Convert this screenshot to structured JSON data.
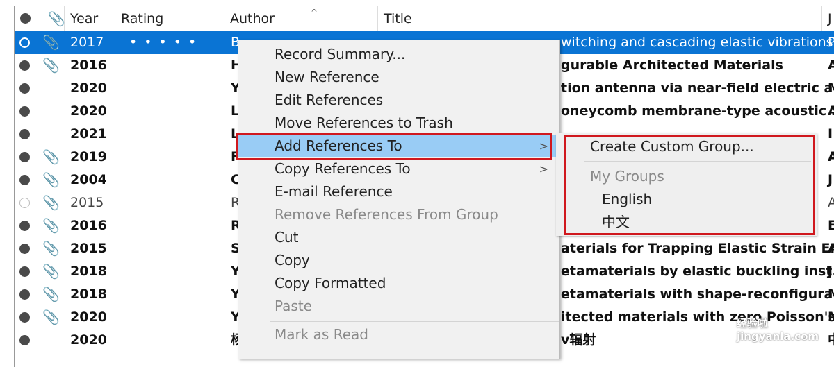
{
  "columns": {
    "year": "Year",
    "rating": "Rating",
    "author": "Author",
    "title": "Title",
    "journal": "J"
  },
  "icons": {
    "read_status": "circle-dot-icon",
    "attachment": "paperclip-icon",
    "sort": "chevron-up-icon",
    "submenu": "chevron-right-icon"
  },
  "rows": [
    {
      "year": "2017",
      "rating": "• • • • •",
      "author": "B",
      "title": "witching and cascading elastic vibrations",
      "journal": "P",
      "attach": true,
      "state": "selected"
    },
    {
      "year": "2016",
      "author": "H",
      "title": "gurable Architected Materials",
      "journal": "A",
      "attach": true,
      "state": "unread"
    },
    {
      "year": "2020",
      "author": "Y",
      "title": "tion antenna via near-field electric a...",
      "journal": "M",
      "attach": false,
      "state": "unread"
    },
    {
      "year": "2020",
      "author": "L",
      "title": "oneycomb membrane-type acoustic ...",
      "journal": "A",
      "attach": false,
      "state": "unread"
    },
    {
      "year": "2021",
      "author": "L",
      "title": "",
      "journal": "I",
      "attach": false,
      "state": "unread"
    },
    {
      "year": "2019",
      "author": "F",
      "title": "",
      "journal": "A",
      "attach": true,
      "state": "unread"
    },
    {
      "year": "2004",
      "author": "C",
      "title": "",
      "journal": "J",
      "attach": true,
      "state": "unread"
    },
    {
      "year": "2015",
      "author": "R",
      "title": "",
      "journal": "A",
      "attach": true,
      "state": "read"
    },
    {
      "year": "2016",
      "author": "R",
      "title": "",
      "journal": "E",
      "attach": true,
      "state": "unread"
    },
    {
      "year": "2015",
      "author": "S",
      "title": "aterials for Trapping Elastic Strain En...",
      "journal": "A",
      "attach": true,
      "state": "unread"
    },
    {
      "year": "2018",
      "author": "Y",
      "title": "etamaterials by elastic buckling inst...",
      "journal": "J",
      "attach": true,
      "state": "unread"
    },
    {
      "year": "2018",
      "author": "Y",
      "title": "etamaterials with shape-reconfigura...",
      "journal": "M",
      "attach": true,
      "state": "unread"
    },
    {
      "year": "2020",
      "author": "Y",
      "title": "itected materials with zero Poisson's...",
      "journal": "M",
      "attach": true,
      "state": "unread"
    },
    {
      "year": "2020",
      "author": "杨",
      "title": "v辐射",
      "journal": "中",
      "attach": false,
      "state": "unread"
    }
  ],
  "context_menu": {
    "items": [
      {
        "label": "Record Summary...",
        "disabled": false
      },
      {
        "label": "New Reference",
        "disabled": false
      },
      {
        "label": "Edit References",
        "disabled": false
      },
      {
        "label": "Move References to Trash",
        "disabled": false
      },
      {
        "label": "Add References To",
        "disabled": false,
        "highlighted": true,
        "submenu": true
      },
      {
        "label": "Copy References To",
        "disabled": false,
        "submenu": true
      },
      {
        "label": "E-mail Reference",
        "disabled": false
      },
      {
        "label": "Remove References From Group",
        "disabled": true
      },
      {
        "label": "Cut",
        "disabled": false
      },
      {
        "label": "Copy",
        "disabled": false
      },
      {
        "label": "Copy Formatted",
        "disabled": false
      },
      {
        "label": "Paste",
        "disabled": true
      },
      {
        "label": "Mark as Read",
        "disabled": true
      }
    ]
  },
  "submenu": {
    "create": "Create Custom Group...",
    "section": "My Groups",
    "groups": [
      "English",
      "中文"
    ]
  },
  "watermark": "经验啦 jingyanla.com",
  "colors": {
    "selection": "#0a74d4",
    "highlight": "#99ccf5",
    "annotation": "#d0181e"
  }
}
